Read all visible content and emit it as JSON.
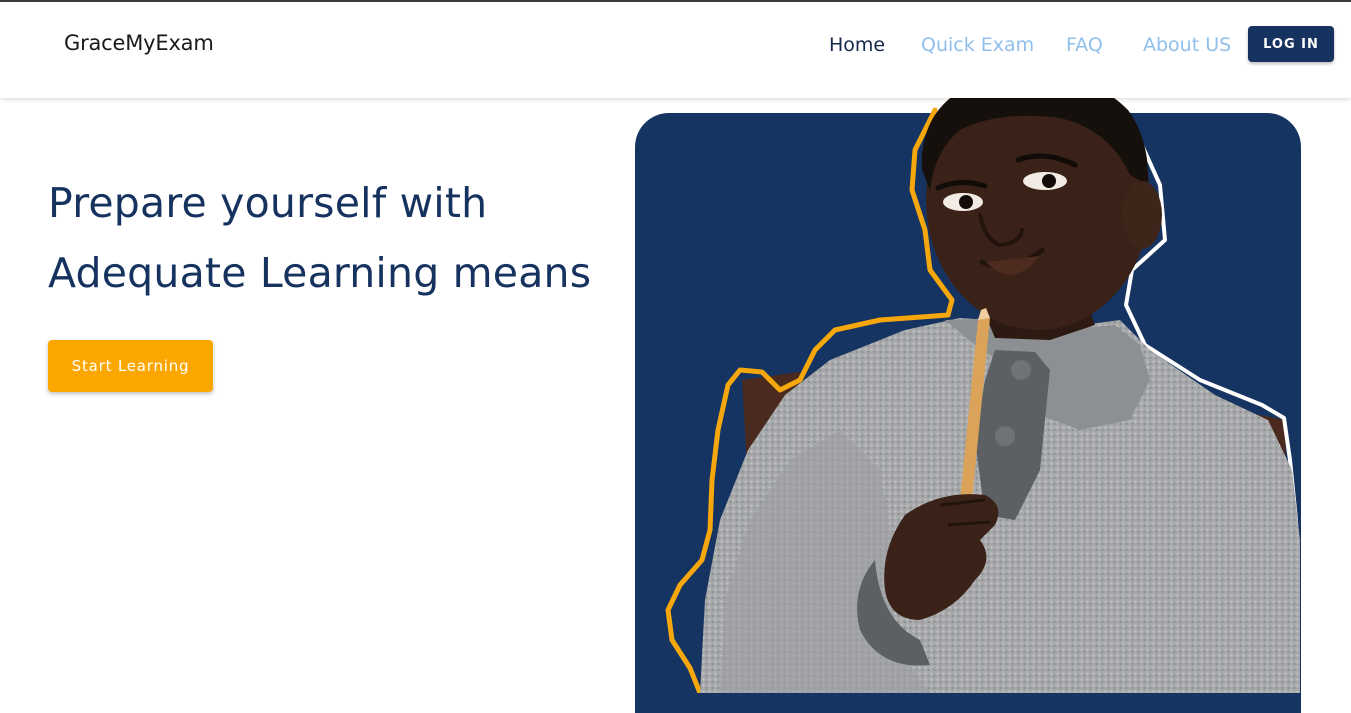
{
  "header": {
    "brand": "GraceMyExam",
    "nav": {
      "home": "Home",
      "quick_exam": "Quick Exam",
      "faq": "FAQ",
      "about": "About US"
    },
    "login_label": "LOG IN"
  },
  "hero": {
    "title_line1": "Prepare yourself with",
    "title_line2": "Adequate Learning means",
    "cta_label": "Start Learning"
  },
  "colors": {
    "navy": "#16325f",
    "accent_orange": "#fba700",
    "link_light_blue": "#8fbfec"
  }
}
